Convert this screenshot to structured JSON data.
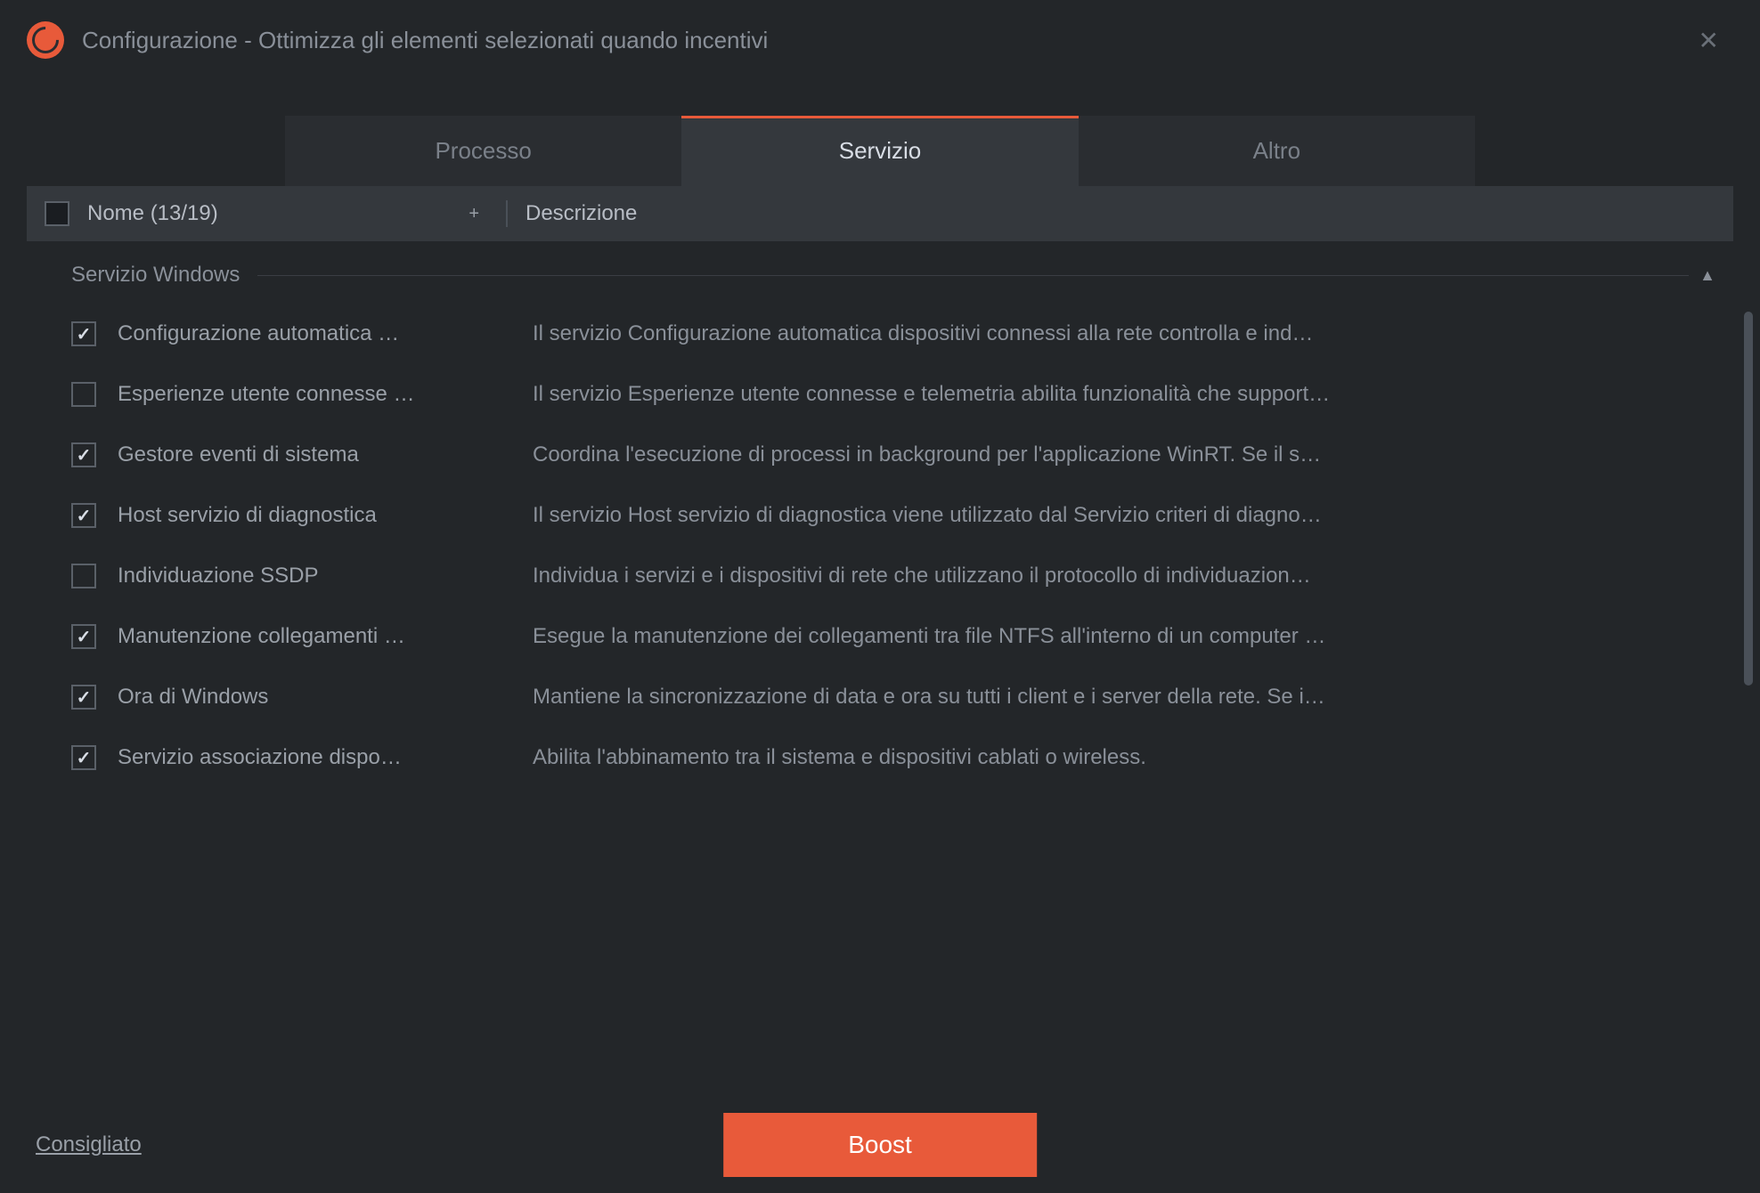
{
  "window": {
    "title": "Configurazione - Ottimizza gli elementi selezionati quando incentivi"
  },
  "tabs": [
    {
      "label": "Processo",
      "active": false
    },
    {
      "label": "Servizio",
      "active": true
    },
    {
      "label": "Altro",
      "active": false
    }
  ],
  "table": {
    "name_header": "Nome (13/19)",
    "desc_header": "Descrizione",
    "sort_indicator": "+"
  },
  "group": {
    "title": "Servizio Windows",
    "collapse_icon": "▲"
  },
  "rows": [
    {
      "checked": true,
      "name": "Configurazione automatica …",
      "desc": "Il servizio Configurazione automatica dispositivi connessi alla rete controlla e ind…"
    },
    {
      "checked": false,
      "name": "Esperienze utente connesse …",
      "desc": "Il servizio Esperienze utente connesse e telemetria abilita funzionalità che support…"
    },
    {
      "checked": true,
      "name": "Gestore eventi di sistema",
      "desc": "Coordina l'esecuzione di processi in background per l'applicazione WinRT. Se il s…"
    },
    {
      "checked": true,
      "name": "Host servizio di diagnostica",
      "desc": "Il servizio Host servizio di diagnostica viene utilizzato dal Servizio criteri di diagno…"
    },
    {
      "checked": false,
      "name": "Individuazione SSDP",
      "desc": "Individua i servizi e i dispositivi di rete che utilizzano il protocollo di individuazion…"
    },
    {
      "checked": true,
      "name": "Manutenzione collegamenti …",
      "desc": "Esegue la manutenzione dei collegamenti tra file NTFS all'interno di un computer …"
    },
    {
      "checked": true,
      "name": "Ora di Windows",
      "desc": "Mantiene la sincronizzazione di data e ora su tutti i client e i server della rete. Se i…"
    },
    {
      "checked": true,
      "name": "Servizio associazione dispo…",
      "desc": "Abilita l'abbinamento tra il sistema e dispositivi cablati o wireless."
    }
  ],
  "footer": {
    "recommended": "Consigliato",
    "boost": "Boost"
  }
}
